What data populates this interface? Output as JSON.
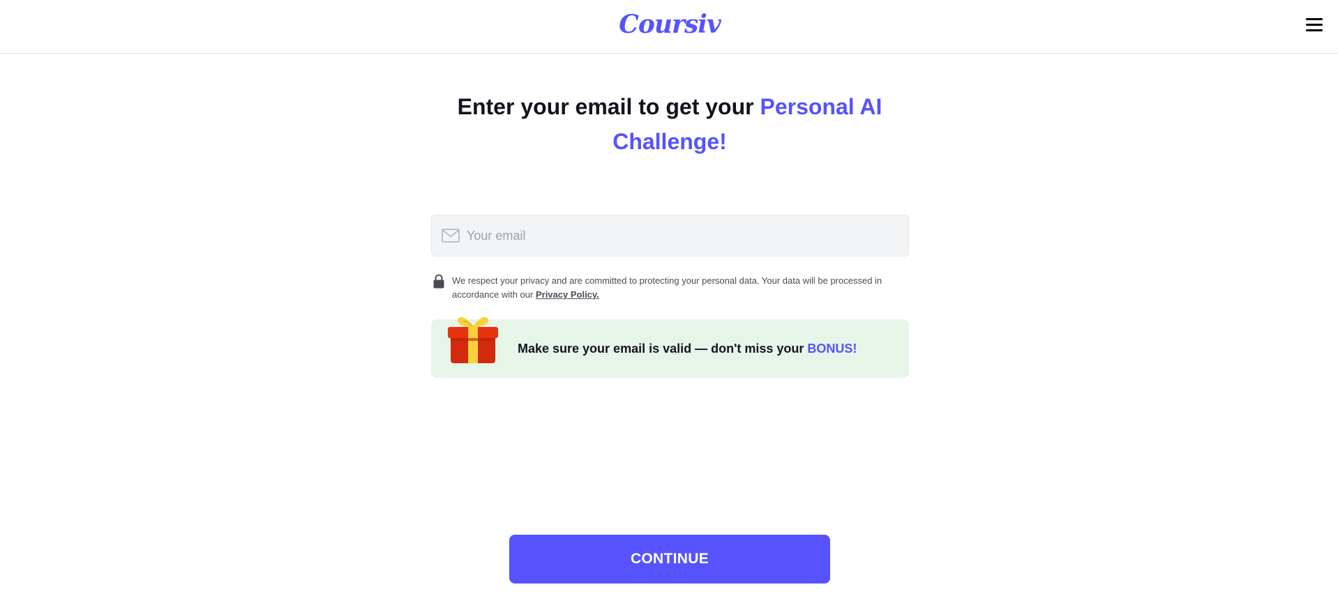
{
  "header": {
    "logo_text": "Coursiv",
    "menu_icon": "hamburger-menu-icon"
  },
  "headline": {
    "text": "Enter your email to get your",
    "accent_line1": "Personal AI",
    "accent_line2": "Challenge!"
  },
  "email": {
    "placeholder": "Your email",
    "value": "",
    "icon": "envelope-icon"
  },
  "privacy": {
    "icon": "lock-icon",
    "text": "We respect your privacy and are committed to protecting your personal data. Your data will be processed in accordance with our",
    "link": "Privacy Policy."
  },
  "bonus": {
    "icon": "gift-icon",
    "text": "Make sure your email is valid — don't miss your",
    "accent": "BONUS!"
  },
  "continue_label": "CONTINUE",
  "colors": {
    "accent": "#5653fe",
    "bonus_bg": "#e6f5e8",
    "input_bg": "#f3f4f6"
  }
}
